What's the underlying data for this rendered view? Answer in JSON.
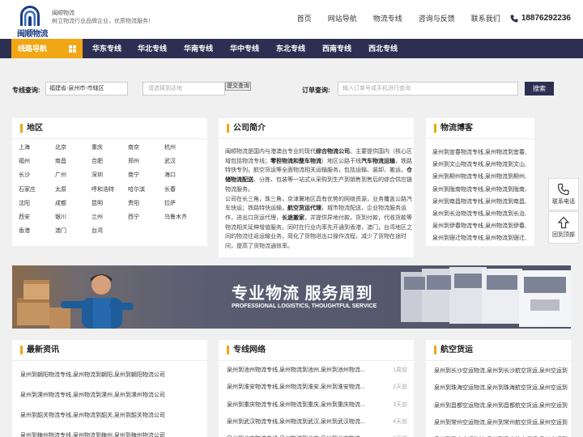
{
  "brand": {
    "logo_text": "闽顺物流",
    "name": "闽顺物流",
    "slogan": "树立物流行业品牌企业，优质物流服务！"
  },
  "top_nav": {
    "items": [
      "首页",
      "网站导航",
      "物流专线",
      "咨询与反馈",
      "联系我们"
    ],
    "phone": "18876292236"
  },
  "nav": {
    "home": "线路导航",
    "items": [
      "华东专线",
      "华北专线",
      "华南专线",
      "华中专线",
      "东北专线",
      "西南专线",
      "西北专线"
    ]
  },
  "search": {
    "line_label": "专线查询:",
    "origin": "福建省-泉州市-市辖区",
    "dest_placeholder": "请选择到达地",
    "submit": "提交查询",
    "order_label": "订单查询:",
    "order_placeholder": "输入订单号或手机进行查询",
    "search_btn": "搜索"
  },
  "region_panel": {
    "title": "地区",
    "items": [
      "上海",
      "北京",
      "重庆",
      "南京",
      "杭州",
      "福州",
      "南昌",
      "合肥",
      "郑州",
      "武汉",
      "长沙",
      "广州",
      "深圳",
      "南宁",
      "海口",
      "石家庄",
      "太原",
      "呼和浩特",
      "哈尔滨",
      "长春",
      "沈阳",
      "成都",
      "昆明",
      "贵阳",
      "拉萨",
      "西安",
      "银川",
      "兰州",
      "西宁",
      "乌鲁木齐",
      "香港",
      "澳门",
      "台湾"
    ]
  },
  "intro_panel": {
    "title": "公司简介",
    "paragraphs": [
      [
        {
          "t": "闽顺物流是国内与港澳台专业的现代",
          "b": false
        },
        {
          "t": "综合物流公司",
          "b": true
        },
        {
          "t": "。主要提供国内（核心区域包括物流专线；",
          "b": false
        },
        {
          "t": "零担物流和整车物流",
          "b": true
        },
        {
          "t": "）地区公路干线",
          "b": false
        },
        {
          "t": "汽车物流运输",
          "b": true
        },
        {
          "t": "，铁路特快专列，航空货运等全面物流相关运输服务，包括运输、装卸、搬运，",
          "b": false
        },
        {
          "t": "仓储物流配送",
          "b": true
        },
        {
          "t": "、分拣、包装等一站式从采购到生产到销售到售后的综合供应链物流服务。",
          "b": false
        }
      ],
      [
        {
          "t": "公司在长三角，珠三角，京津冀地区具有优势的网络资源，业务覆盖公路汽车快运；铁路特快运输，",
          "b": false
        },
        {
          "t": "航空货运代理",
          "b": true
        },
        {
          "t": "，城市物流配送，企业物流服务运作，进出口货运代理，",
          "b": false
        },
        {
          "t": "长途搬家",
          "b": true
        },
        {
          "t": "，并提供异地付款，货到付款，代收货款等物流相关延伸增值服务。同时在行业内率先开通到香港，澳门，台湾地区之间的物流往返运输业务，简化了货物进出口操作流程，减少了货物在途时间，提高了货物流通效率。",
          "b": false
        }
      ]
    ]
  },
  "blog_panel": {
    "title": "物流博客",
    "items": [
      "泉州到宣春物流专线,泉州物流到宜春,",
      "泉州到文山物流专线,泉州物流到文山,",
      "泉州到柳州物流专线,泉州物流到柳州,",
      "泉州到陇南物流专线,泉州物流到陇南,",
      "泉州到南昌物流专线,泉州物流到南昌,",
      "泉州到长治物流专线,泉州物流到长治,",
      "泉州到伊春物流专线,泉州物流到伊春,",
      "泉州到宿迁物流专线,泉州物流到宿迁,"
    ]
  },
  "float_tools": {
    "phone_label": "联系电话",
    "top_label": "回到顶部"
  },
  "banner": {
    "title_cn": "专业物流  服务周到",
    "title_en": "PROFESSIONAL LOGISTICS, THOUGHTFUL SERVICE"
  },
  "news_panel": {
    "title": "最新资讯",
    "items": [
      "泉州到朝阳物流专线,泉州物流到朝阳,泉州到朝阳物流公司",
      "泉州到漯州物流专线,泉州物流到漯州,泉州到漯州物流公司",
      "泉州到韶关物流专线,泉州物流到韶关,泉州到韶关物流公司",
      "泉州到梅州物流专线,泉州物流到梅州,泉州到梅州物流公司"
    ]
  },
  "lines_panel": {
    "title": "专线网络",
    "items": [
      {
        "text": "泉州到池州物流专线,泉州物流到池州,泉州到池州物流...",
        "meta": "1周前"
      },
      {
        "text": "泉州到淮安物流专线,泉州物流到淮安,泉州到淮安物流...",
        "meta": "2天前"
      },
      {
        "text": "泉州到重庆物流专线,泉州物流到重庆,泉州到重庆物流...",
        "meta": "3天前"
      },
      {
        "text": "泉州到武汉物流专线,泉州物流到武汉,泉州到武汉物流...",
        "meta": "4天前"
      },
      {
        "text": "泉州到北京物流专线,泉州物流到北京,泉州到北京物流...",
        "meta": "5天前"
      }
    ]
  },
  "air_panel": {
    "title": "航空货运",
    "items": [
      "泉州到长沙空运物流,泉州到长沙航空货运,泉州空运到",
      "泉州到珠海空运物流,泉州到珠海航空货运,泉州空运到",
      "泉州到昌都空运物流,泉州到昌都航空货运,泉州空运到",
      "泉州到常州空运物流,泉州到常州航空货运,泉州空运到",
      "泉州到重庆空运物流,泉州到重庆航空货运,泉州空运到"
    ]
  },
  "colors": {
    "nav_bg": "#2d2f52",
    "accent": "#f1a614",
    "brand": "#1f3c84"
  }
}
